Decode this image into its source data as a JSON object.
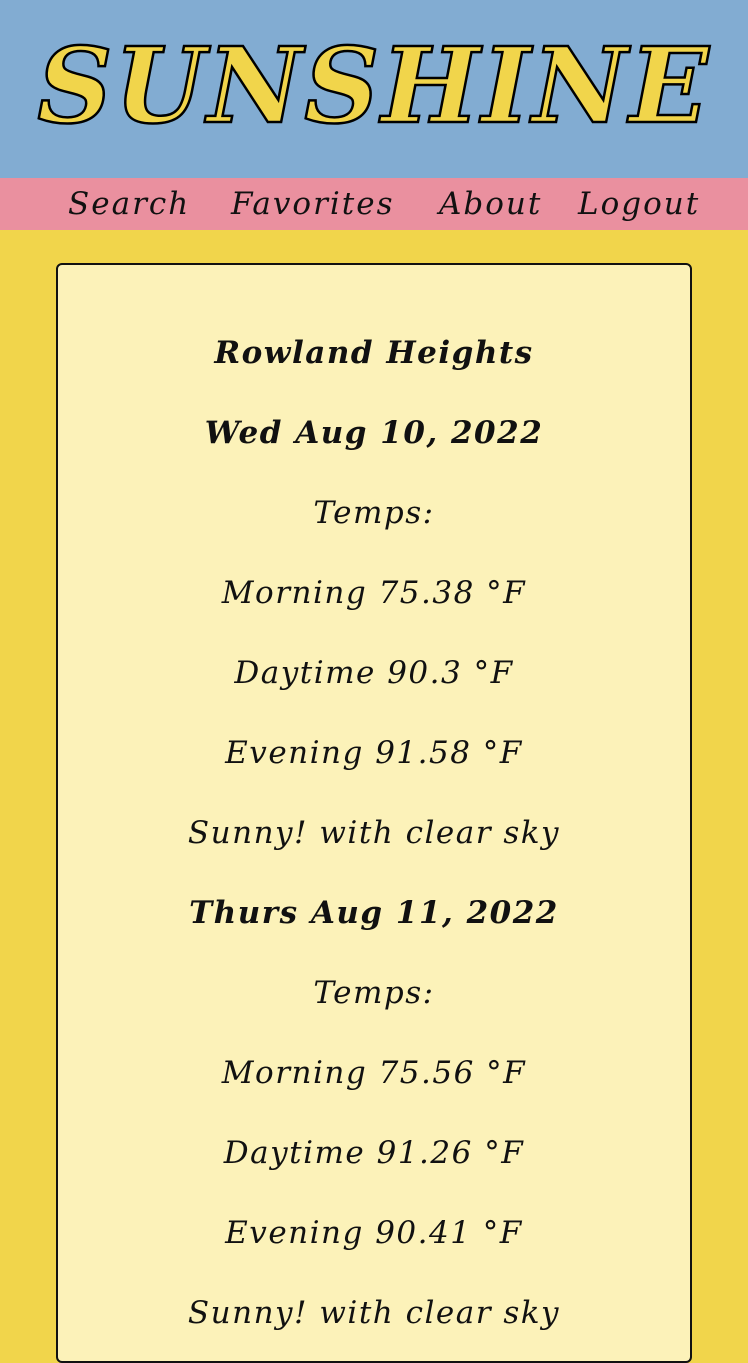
{
  "header": {
    "logo_text": "SUNSHINE",
    "background_color": "#82acd2",
    "logo_color": "#f1d54b"
  },
  "nav": {
    "background_color": "#ea909f",
    "items": [
      {
        "label": "Search"
      },
      {
        "label": "Favorites"
      },
      {
        "label": "About"
      },
      {
        "label": "Logout"
      }
    ]
  },
  "forecast": {
    "location": "Rowland Heights",
    "days": [
      {
        "date": "Wed Aug 10, 2022",
        "temps_label": "Temps:",
        "morning": "Morning 75.38 °F",
        "daytime": "Daytime 90.3 °F",
        "evening": "Evening 91.58 °F",
        "condition": "Sunny! with clear sky"
      },
      {
        "date": "Thurs Aug 11, 2022",
        "temps_label": "Temps:",
        "morning": "Morning 75.56 °F",
        "daytime": "Daytime 91.26 °F",
        "evening": "Evening 90.41 °F",
        "condition": "Sunny! with clear sky"
      }
    ]
  },
  "colors": {
    "page_background": "#f1d54b",
    "card_background": "#fcf2b9"
  }
}
